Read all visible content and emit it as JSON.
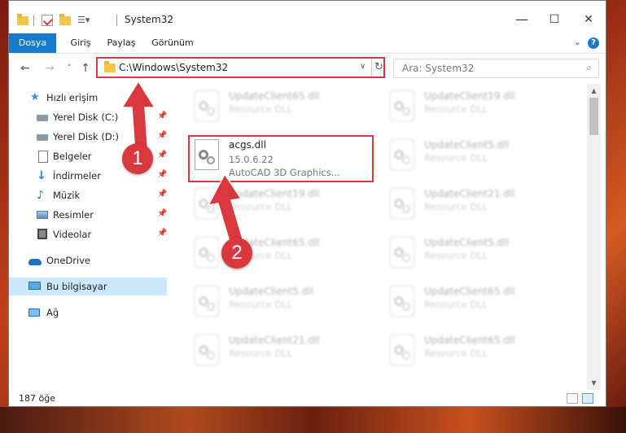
{
  "window": {
    "title": "System32",
    "minimize_glyph": "—",
    "maximize_glyph": "☐",
    "close_glyph": "✕"
  },
  "ribbon": {
    "tabs": [
      {
        "label": "Dosya"
      },
      {
        "label": "Giriş"
      },
      {
        "label": "Paylaş"
      },
      {
        "label": "Görünüm"
      }
    ],
    "help_glyph": "?",
    "collapse_glyph": "⌄"
  },
  "address": {
    "path": "C:\\Windows\\System32",
    "back_glyph": "←",
    "forward_glyph": "→",
    "recent_glyph": "˅",
    "up_glyph": "↑",
    "dropdown_glyph": "∨",
    "refresh_glyph": "↻"
  },
  "search": {
    "placeholder": "Ara: System32",
    "icon_glyph": "⌕"
  },
  "sidebar": {
    "items": [
      {
        "label": "Hızlı erişim",
        "icon": "star-icon"
      },
      {
        "label": "Yerel Disk (C:)",
        "icon": "drive-icon",
        "pinned": true
      },
      {
        "label": "Yerel Disk (D:)",
        "icon": "drive-icon",
        "pinned": true
      },
      {
        "label": "Belgeler",
        "icon": "documents-icon",
        "pinned": true
      },
      {
        "label": "İndirmeler",
        "icon": "download-icon",
        "pinned": true
      },
      {
        "label": "Müzik",
        "icon": "music-icon",
        "pinned": true
      },
      {
        "label": "Resimler",
        "icon": "pictures-icon",
        "pinned": true
      },
      {
        "label": "Videolar",
        "icon": "video-icon",
        "pinned": true
      },
      {
        "label": "OneDrive",
        "icon": "cloud-icon"
      },
      {
        "label": "Bu bilgisayar",
        "icon": "computer-icon",
        "selected": true
      },
      {
        "label": "Ağ",
        "icon": "network-icon"
      }
    ],
    "pin_glyph": "📌"
  },
  "files": {
    "highlighted": {
      "name": "acgs.dll",
      "version": "15.0.6.22",
      "description": "AutoCAD 3D Graphics..."
    },
    "background": [
      {
        "name": "UpdateClient65.dll",
        "type": "Resource DLL"
      },
      {
        "name": "UpdateClient19.dll",
        "type": "Resource DLL"
      },
      {
        "name": "UpdateClient5.dll",
        "type": "Resource DLL"
      },
      {
        "name": "UpdateClient19.dll",
        "type": "Resource DLL"
      },
      {
        "name": "UpdateClient21.dll",
        "type": "Resource DLL"
      },
      {
        "name": "UpdateClient65.dll",
        "type": "Resource DLL"
      },
      {
        "name": "UpdateClient5.dll",
        "type": "Resource DLL"
      },
      {
        "name": "UpdateClient5.dll",
        "type": "Resource DLL"
      },
      {
        "name": "UpdateClient65.dll",
        "type": "Resource DLL"
      },
      {
        "name": "UpdateClient21.dll",
        "type": "Resource DLL"
      },
      {
        "name": "UpdateClient65.dll",
        "type": "Resource DLL"
      }
    ]
  },
  "status": {
    "item_count": "187 öğe"
  },
  "annotations": {
    "step1": "1",
    "step2": "2",
    "accent_color": "#d9383f"
  },
  "colors": {
    "ribbon_file_tab": "#1979ca",
    "selection": "#cce8ff"
  }
}
